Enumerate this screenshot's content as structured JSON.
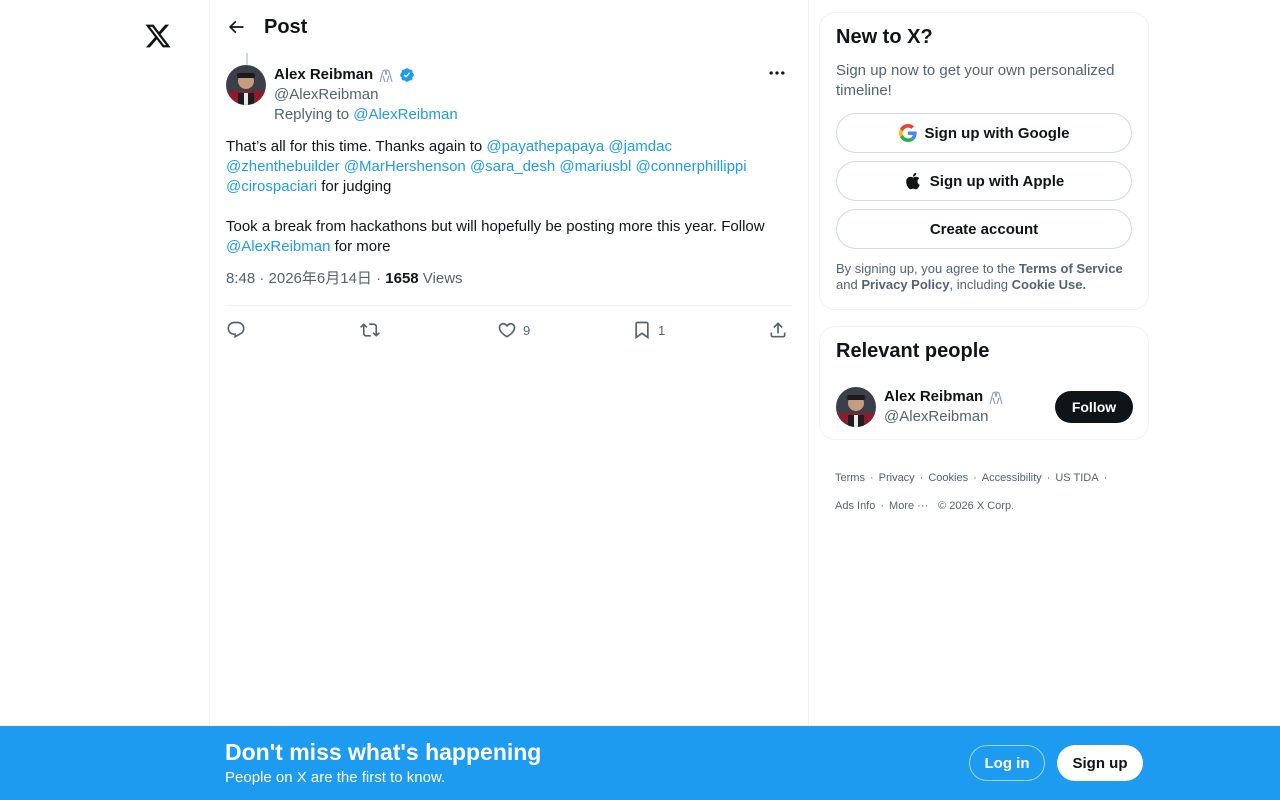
{
  "header": {
    "title": "Post"
  },
  "post": {
    "author_name": "Alex Reibman",
    "author_handle": "@AlexReibman",
    "replying_prefix": "Replying to ",
    "replying_handle": "@AlexReibman",
    "text_intro": "That’s all for this time. Thanks again to ",
    "mentions": [
      "@payathepapaya",
      "@jamdac",
      "@zhenthebuilder",
      "@MarHershenson",
      "@sara_desh",
      "@mariusbl",
      "@connerphillippi",
      "@cirospaciari"
    ],
    "text_after_mentions": " for judging",
    "text_second_pre": "Took a break from hackathons but will hopefully be posting more this year. Follow ",
    "text_second_link": "@AlexReibman",
    "text_second_post": " for more",
    "timestamp": "8:48 · 2026年6月14日 · ",
    "views_count": "1658",
    "views_label": " Views",
    "likes": "9",
    "bookmarks": "1"
  },
  "sidebar": {
    "new_card": {
      "title": "New to X?",
      "subtitle": "Sign up now to get your own personalized timeline!",
      "google_label": "Sign up with Google",
      "apple_label": "Sign up with Apple",
      "create_label": "Create account",
      "legal_1": "By signing up, you agree to the ",
      "legal_terms": "Terms of Service",
      "legal_2": " and ",
      "legal_privacy": "Privacy Policy",
      "legal_3": ", including ",
      "legal_cookie": "Cookie Use."
    },
    "relevant": {
      "title": "Relevant people",
      "name": "Alex Reibman",
      "handle": "@AlexReibman",
      "follow_label": "Follow"
    },
    "footer_row1": [
      "Terms",
      "Privacy",
      "Cookies",
      "Accessibility",
      "US TIDA"
    ],
    "footer_row2": [
      "Ads Info",
      "More ···",
      "© 2026 X Corp."
    ]
  },
  "bottom_bar": {
    "title": "Don't miss what's happening",
    "subtitle": "People on X are the first to know.",
    "login_label": "Log in",
    "signup_label": "Sign up"
  },
  "colors": {
    "accent": "#1d9bf0",
    "text_primary": "#0f1419",
    "text_secondary": "#536471"
  }
}
